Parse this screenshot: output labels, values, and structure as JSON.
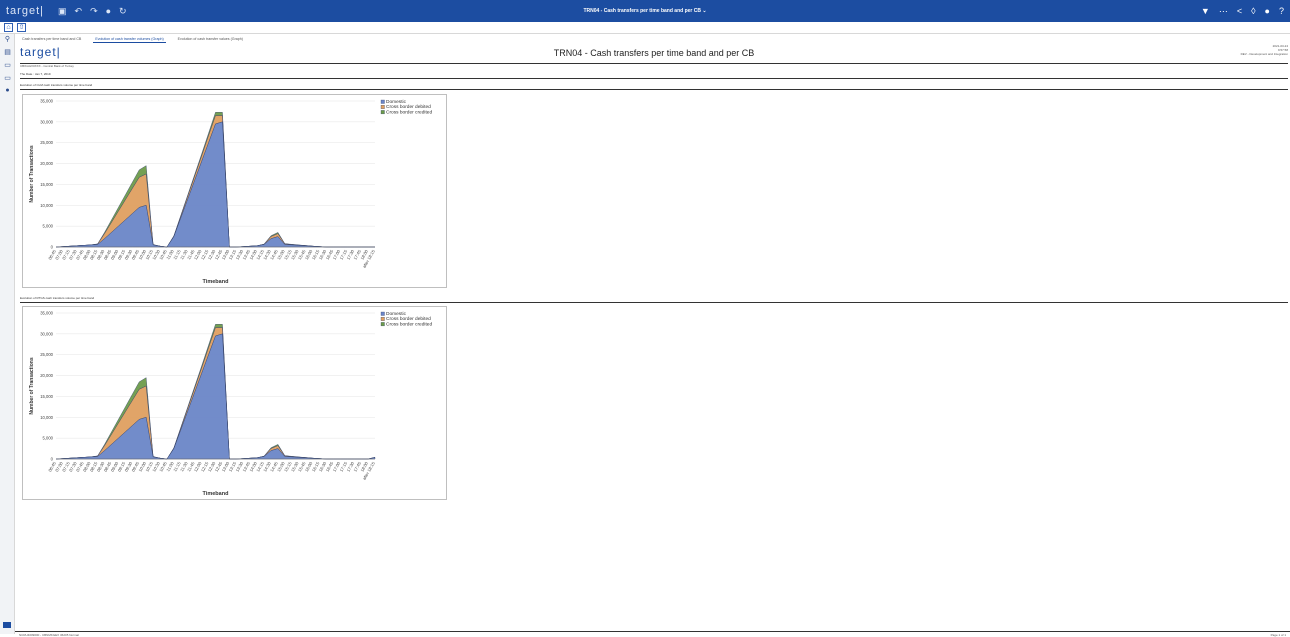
{
  "app": {
    "logo": "target|",
    "window_title": "TRN04 - Cash transfers per time band and per CB ⌄"
  },
  "tabs": [
    {
      "label": "Cash transfers per time band and CB",
      "active": false
    },
    {
      "label": "Evolution of cash transfer volumes (Graph)",
      "active": true
    },
    {
      "label": "Evolution of cash transfer values (Graph)",
      "active": false
    }
  ],
  "report": {
    "brand": "target|",
    "title": "TRN04 - Cash transfers per time band and per CB",
    "meta_line1": "2021-03-24",
    "meta_line2": "9:57:58",
    "meta_line3": "DEV - Development and Integration",
    "cb_line": "CBIKA&X0XXX - Central Bank of Turkey",
    "date_line": "The Date : Jan 7, 2019"
  },
  "footer": {
    "left": "NCRU4009000 - CBNMKGEX 36205 Normal",
    "right": "Page 1 of 1"
  },
  "colors": {
    "domestic": "#6b86c8",
    "cross_debited": "#e0a060",
    "cross_credited": "#6d9b4a",
    "brand": "#1c4da1"
  },
  "chart_data": [
    {
      "section_title": "Evolution of CLM cash transfers volume per time band",
      "type": "area",
      "xlabel": "Timeband",
      "ylabel": "Number of Transactions",
      "ylim": [
        0,
        35000
      ],
      "yticks": [
        "0",
        "5,000",
        "10,000",
        "15,000",
        "20,000",
        "25,000",
        "30,000",
        "35,000"
      ],
      "legend": "top-right",
      "categories": [
        "06:45",
        "07:00",
        "07:15",
        "07:30",
        "07:45",
        "08:00",
        "08:15",
        "08:30",
        "08:45",
        "09:00",
        "09:15",
        "09:30",
        "09:45",
        "10:00",
        "10:15",
        "10:30",
        "10:45",
        "11:00",
        "11:15",
        "11:30",
        "11:45",
        "12:00",
        "12:15",
        "12:30",
        "12:45",
        "13:00",
        "13:15",
        "13:30",
        "13:45",
        "14:00",
        "14:15",
        "14:30",
        "14:45",
        "15:00",
        "15:15",
        "15:30",
        "15:45",
        "16:00",
        "16:15",
        "16:30",
        "16:45",
        "17:00",
        "17:15",
        "17:30",
        "17:45",
        "18:00",
        "after 18:15"
      ],
      "series": [
        {
          "name": "Domestic",
          "values": [
            0,
            100,
            200,
            300,
            400,
            500,
            600,
            2000,
            3500,
            5000,
            6500,
            8000,
            9500,
            10000,
            500,
            200,
            0,
            2500,
            7000,
            11500,
            16000,
            20500,
            25000,
            29500,
            30000,
            0,
            0,
            100,
            200,
            300,
            600,
            2000,
            2500,
            600,
            500,
            400,
            300,
            200,
            100,
            0,
            0,
            0,
            0,
            0,
            0,
            0,
            0
          ]
        },
        {
          "name": "Cross border debited",
          "values": [
            0,
            0,
            0,
            0,
            0,
            0,
            100,
            1200,
            2400,
            3600,
            4800,
            6000,
            7200,
            7500,
            50,
            0,
            0,
            100,
            400,
            700,
            1000,
            1300,
            1700,
            2000,
            1500,
            0,
            0,
            0,
            0,
            0,
            50,
            500,
            700,
            150,
            100,
            50,
            50,
            0,
            0,
            0,
            0,
            0,
            0,
            0,
            0,
            0,
            0
          ]
        },
        {
          "name": "Cross border credited",
          "values": [
            0,
            0,
            0,
            0,
            0,
            0,
            50,
            300,
            600,
            900,
            1200,
            1500,
            1800,
            2000,
            50,
            0,
            0,
            100,
            200,
            300,
            400,
            500,
            600,
            800,
            800,
            0,
            0,
            0,
            0,
            0,
            50,
            200,
            300,
            50,
            50,
            50,
            0,
            0,
            0,
            0,
            0,
            0,
            0,
            0,
            0,
            0,
            0
          ]
        }
      ]
    },
    {
      "section_title": "Evolution of RTGS cash transfers volume per time band",
      "type": "area",
      "xlabel": "Timeband",
      "ylabel": "Number of Transactions",
      "ylim": [
        0,
        35000
      ],
      "yticks": [
        "0",
        "5,000",
        "10,000",
        "15,000",
        "20,000",
        "25,000",
        "30,000",
        "35,000"
      ],
      "legend": "top-right",
      "categories": [
        "06:45",
        "07:00",
        "07:15",
        "07:30",
        "07:45",
        "08:00",
        "08:15",
        "08:30",
        "08:45",
        "09:00",
        "09:15",
        "09:30",
        "09:45",
        "10:00",
        "10:15",
        "10:30",
        "10:45",
        "11:00",
        "11:15",
        "11:30",
        "11:45",
        "12:00",
        "12:15",
        "12:30",
        "12:45",
        "13:00",
        "13:15",
        "13:30",
        "13:45",
        "14:00",
        "14:15",
        "14:30",
        "14:45",
        "15:00",
        "15:15",
        "15:30",
        "15:45",
        "16:00",
        "16:15",
        "16:30",
        "16:45",
        "17:00",
        "17:15",
        "17:30",
        "17:45",
        "18:00",
        "after 18:15"
      ],
      "series": [
        {
          "name": "Domestic",
          "values": [
            0,
            100,
            200,
            300,
            400,
            500,
            600,
            2000,
            3500,
            5000,
            6500,
            8000,
            9500,
            10000,
            500,
            200,
            0,
            2500,
            7000,
            11500,
            16000,
            20500,
            25000,
            29500,
            30000,
            0,
            0,
            100,
            200,
            300,
            600,
            2000,
            2500,
            600,
            500,
            400,
            300,
            200,
            100,
            0,
            0,
            0,
            0,
            0,
            0,
            0,
            400
          ]
        },
        {
          "name": "Cross border debited",
          "values": [
            0,
            0,
            0,
            0,
            0,
            0,
            100,
            1200,
            2400,
            3600,
            4800,
            6000,
            7200,
            7500,
            50,
            0,
            0,
            100,
            400,
            700,
            1000,
            1300,
            1700,
            2000,
            1500,
            0,
            0,
            0,
            0,
            0,
            50,
            500,
            700,
            150,
            100,
            50,
            50,
            0,
            0,
            0,
            0,
            0,
            0,
            0,
            0,
            0,
            0
          ]
        },
        {
          "name": "Cross border credited",
          "values": [
            0,
            0,
            0,
            0,
            0,
            0,
            50,
            300,
            600,
            900,
            1200,
            1500,
            1800,
            2000,
            50,
            0,
            0,
            100,
            200,
            300,
            400,
            500,
            600,
            800,
            800,
            0,
            0,
            0,
            0,
            0,
            50,
            200,
            300,
            50,
            50,
            50,
            0,
            0,
            0,
            0,
            0,
            0,
            0,
            0,
            0,
            0,
            0
          ]
        }
      ]
    }
  ]
}
